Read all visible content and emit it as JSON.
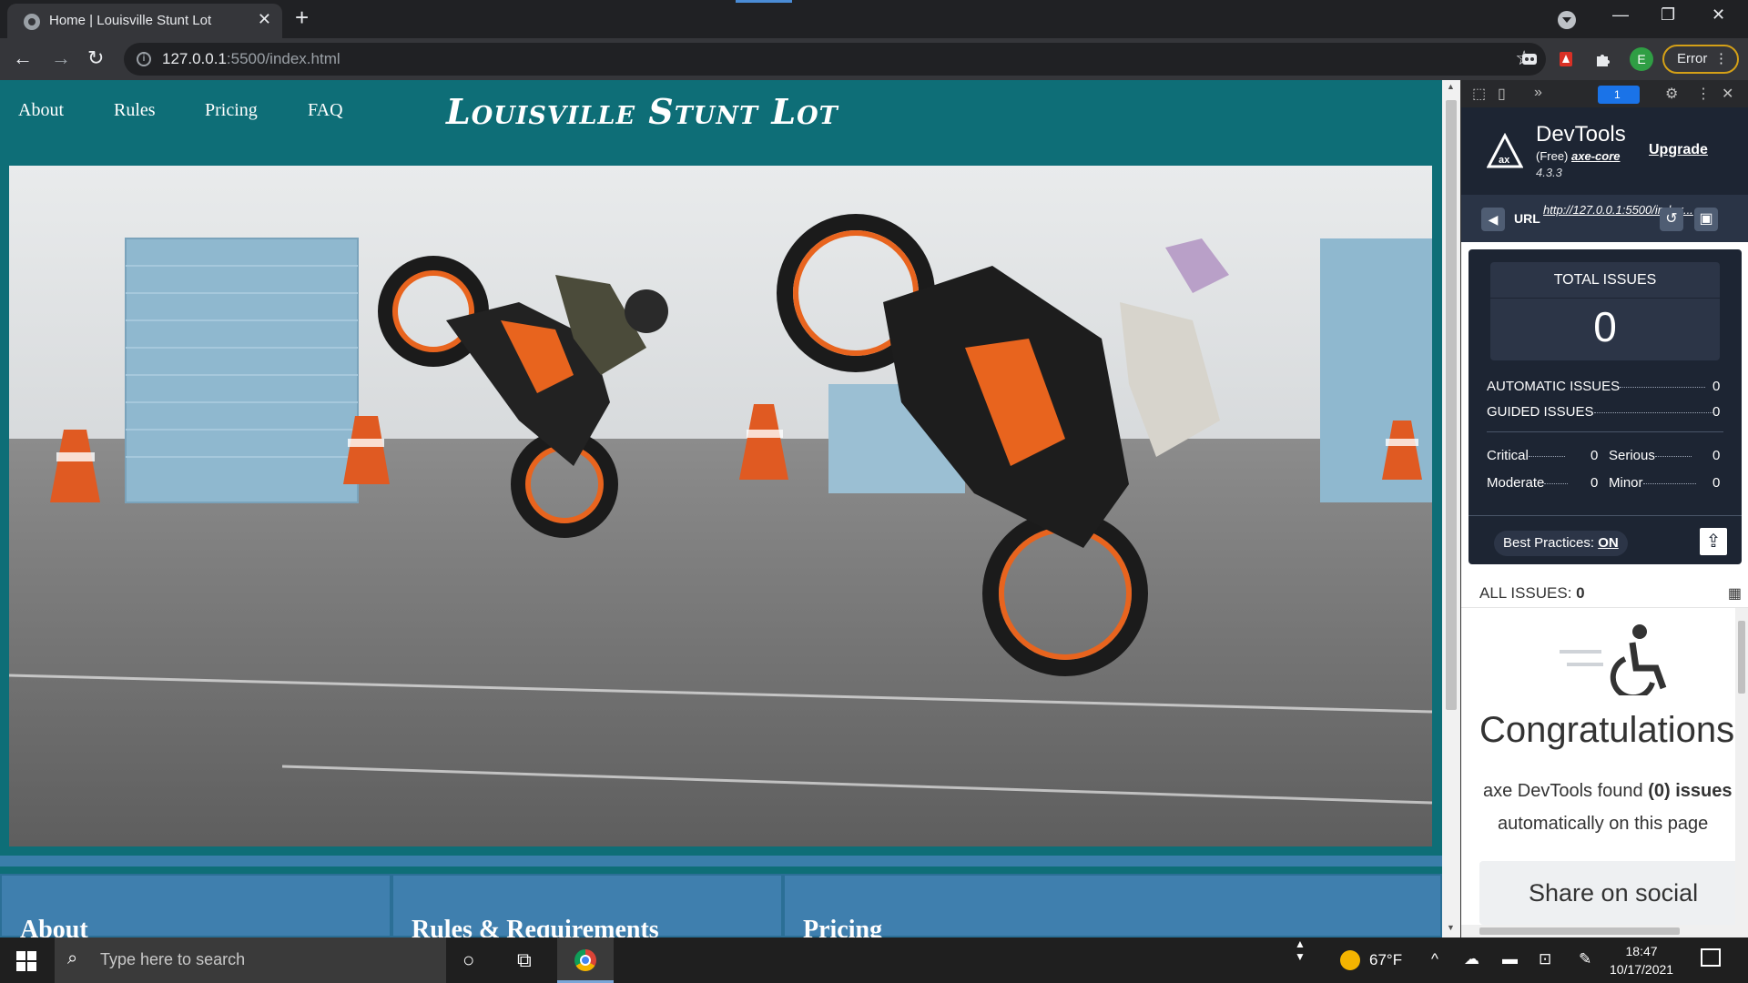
{
  "browser": {
    "tab_title": "Home | Louisville Stunt Lot",
    "url_host": "127.0.0.1",
    "url_path": ":5500/index.html",
    "profile_initial": "E",
    "error_label": "Error"
  },
  "site": {
    "nav": [
      "About",
      "Rules",
      "Pricing",
      "FAQ"
    ],
    "title": "Louisville Stunt Lot",
    "hero_image": "motorcycle-stunt-photo",
    "cards": [
      "About",
      "Rules & Requirements",
      "Pricing"
    ],
    "colors": {
      "header_bg": "#0e6e77",
      "card_bg": "#3f7fae"
    }
  },
  "devtools": {
    "badge_count": "1",
    "brand": "DevTools",
    "free_label": "(Free)",
    "engine": "axe-core",
    "version": "4.3.3",
    "upgrade": "Upgrade",
    "url_label": "URL",
    "url_value": "http://127.0.0.1:5500/index...",
    "total_issues_label": "TOTAL ISSUES",
    "total_issues": "0",
    "automatic_label": "AUTOMATIC ISSUES",
    "automatic": "0",
    "guided_label": "GUIDED ISSUES",
    "guided": "0",
    "critical_label": "Critical",
    "critical": "0",
    "serious_label": "Serious",
    "serious": "0",
    "moderate_label": "Moderate",
    "moderate": "0",
    "minor_label": "Minor",
    "minor": "0",
    "best_practices_label": "Best Practices:",
    "best_practices_value": "ON",
    "all_issues_label": "ALL ISSUES:",
    "all_issues_count": "0",
    "congrats": "Congratulations",
    "found_prefix": "axe DevTools found",
    "found_count": "(0)",
    "found_suffix": "issues",
    "found_line2": "automatically on this page",
    "share": "Share on social"
  },
  "taskbar": {
    "search_placeholder": "Type here to search",
    "temperature": "67°F",
    "time": "18:47",
    "date": "10/17/2021"
  }
}
